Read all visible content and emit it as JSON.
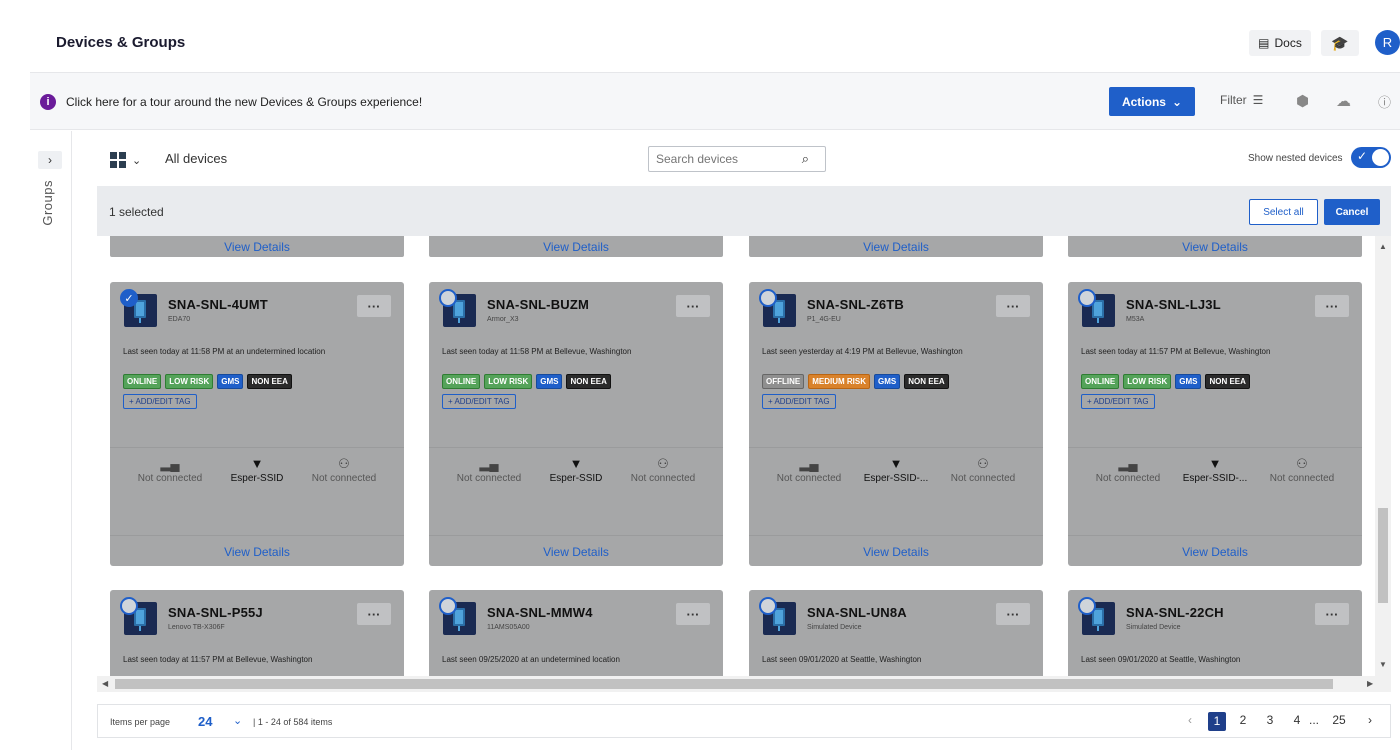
{
  "header": {
    "title": "Devices & Groups",
    "docs_label": "Docs",
    "avatar_initial": "R"
  },
  "tour": {
    "text": "Click here for a tour around the new Devices & Groups experience!"
  },
  "toolbar": {
    "actions_label": "Actions",
    "filter_label": "Filter"
  },
  "sidebar": {
    "groups_label": "Groups"
  },
  "view": {
    "all_devices_label": "All devices",
    "search_placeholder": "Search devices",
    "nested_label": "Show nested devices",
    "nested_enabled": true
  },
  "selection": {
    "text": "1 selected",
    "select_all_label": "Select all",
    "cancel_label": "Cancel"
  },
  "view_details_label": "View Details",
  "add_tag_label": "+ ADD/EDIT TAG",
  "cards_row1": [
    {
      "name": "SNA-SNL-4UMT",
      "model": "EDA70",
      "selected": true,
      "last_seen": "Last seen today at 11:58 PM at an undetermined location",
      "tags": [
        "ONLINE",
        "LOW RISK",
        "GMS",
        "NON EEA"
      ],
      "cellular": "Not connected",
      "wifi": "Esper-SSID",
      "ethernet": "Not connected"
    },
    {
      "name": "SNA-SNL-BUZM",
      "model": "Armor_X3",
      "selected": false,
      "last_seen": "Last seen today at 11:58 PM at Bellevue, Washington",
      "tags": [
        "ONLINE",
        "LOW RISK",
        "GMS",
        "NON EEA"
      ],
      "cellular": "Not connected",
      "wifi": "Esper-SSID",
      "ethernet": "Not connected"
    },
    {
      "name": "SNA-SNL-Z6TB",
      "model": "P1_4G-EU",
      "selected": false,
      "last_seen": "Last seen yesterday at 4:19 PM at Bellevue, Washington",
      "tags": [
        "OFFLINE",
        "MEDIUM RISK",
        "GMS",
        "NON EEA"
      ],
      "cellular": "Not connected",
      "wifi": "Esper-SSID-...",
      "ethernet": "Not connected"
    },
    {
      "name": "SNA-SNL-LJ3L",
      "model": "M53A",
      "selected": false,
      "last_seen": "Last seen today at 11:57 PM at Bellevue, Washington",
      "tags": [
        "ONLINE",
        "LOW RISK",
        "GMS",
        "NON EEA"
      ],
      "cellular": "Not connected",
      "wifi": "Esper-SSID-...",
      "ethernet": "Not connected"
    }
  ],
  "cards_row2": [
    {
      "name": "SNA-SNL-P55J",
      "model": "Lenovo TB-X306F",
      "selected": false,
      "last_seen": "Last seen today at 11:57 PM at Bellevue, Washington"
    },
    {
      "name": "SNA-SNL-MMW4",
      "model": "11AMS05A00",
      "selected": false,
      "last_seen": "Last seen 09/25/2020 at an undetermined location"
    },
    {
      "name": "SNA-SNL-UN8A",
      "model": "Simulated Device",
      "selected": false,
      "last_seen": "Last seen 09/01/2020 at Seattle, Washington"
    },
    {
      "name": "SNA-SNL-22CH",
      "model": "Simulated Device",
      "selected": false,
      "last_seen": "Last seen 09/01/2020 at Seattle, Washington"
    }
  ],
  "pagination": {
    "items_per_page_label": "Items per page",
    "items_per_page": "24",
    "range": "| 1 - 24 of 584 items",
    "pages": [
      "1",
      "2",
      "3",
      "4",
      "...",
      "25"
    ],
    "current": "1"
  },
  "colors": {
    "accent": "#1f5fc9",
    "card_overlay": "#a6a7a8",
    "online": "#55a35a",
    "medium_risk": "#d9822b"
  }
}
